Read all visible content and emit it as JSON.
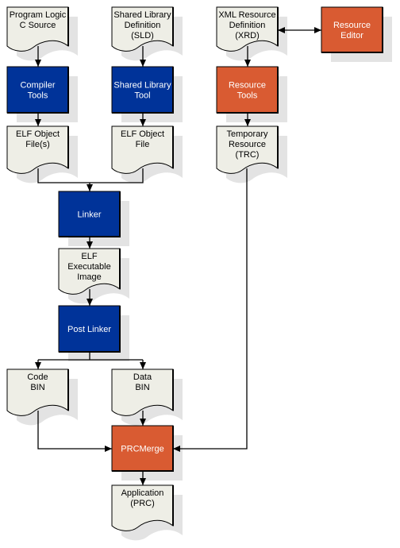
{
  "colors": {
    "process_blue": "#003399",
    "process_orange": "#d95b32",
    "document_fill": "#eeeee6",
    "shadow": "#e3e3e3"
  },
  "nodes": {
    "program_logic": {
      "kind": "document",
      "lines": [
        "Program Logic",
        "C Source"
      ]
    },
    "sld": {
      "kind": "document",
      "lines": [
        "Shared Library",
        "Definition",
        "(SLD)"
      ]
    },
    "xrd": {
      "kind": "document",
      "lines": [
        "XML Resource",
        "Definition",
        "(XRD)"
      ]
    },
    "resource_editor": {
      "kind": "process",
      "color": "orange",
      "lines": [
        "Resource",
        "Editor"
      ]
    },
    "compiler_tools": {
      "kind": "process",
      "color": "blue",
      "lines": [
        "Compiler",
        "Tools"
      ]
    },
    "shared_library_tool": {
      "kind": "process",
      "color": "blue",
      "lines": [
        "Shared Library",
        "Tool"
      ]
    },
    "resource_tools": {
      "kind": "process",
      "color": "orange",
      "lines": [
        "Resource",
        "Tools"
      ]
    },
    "elf_object_files": {
      "kind": "document",
      "lines": [
        "ELF Object",
        "File(s)"
      ]
    },
    "elf_object_file": {
      "kind": "document",
      "lines": [
        "ELF Object",
        "File"
      ]
    },
    "trc": {
      "kind": "document",
      "lines": [
        "Temporary",
        "Resource",
        "(TRC)"
      ]
    },
    "linker": {
      "kind": "process",
      "color": "blue",
      "lines": [
        "Linker"
      ]
    },
    "elf_executable": {
      "kind": "document",
      "lines": [
        "ELF",
        "Executable",
        "Image"
      ]
    },
    "post_linker": {
      "kind": "process",
      "color": "blue",
      "lines": [
        "Post Linker"
      ]
    },
    "code_bin": {
      "kind": "document",
      "lines": [
        "Code",
        "BIN"
      ]
    },
    "data_bin": {
      "kind": "document",
      "lines": [
        "Data",
        "BIN"
      ]
    },
    "prcmerge": {
      "kind": "process",
      "color": "orange",
      "lines": [
        "PRCMerge"
      ]
    },
    "application": {
      "kind": "document",
      "lines": [
        "Application",
        "(PRC)"
      ]
    }
  },
  "edges": [
    {
      "from": "program_logic",
      "to": "compiler_tools"
    },
    {
      "from": "compiler_tools",
      "to": "elf_object_files"
    },
    {
      "from": "sld",
      "to": "shared_library_tool"
    },
    {
      "from": "shared_library_tool",
      "to": "elf_object_file"
    },
    {
      "from": "xrd",
      "to": "resource_editor",
      "bidirectional": true
    },
    {
      "from": "xrd",
      "to": "resource_tools"
    },
    {
      "from": "resource_tools",
      "to": "trc"
    },
    {
      "from": "elf_object_files",
      "to": "linker"
    },
    {
      "from": "elf_object_file",
      "to": "linker"
    },
    {
      "from": "linker",
      "to": "elf_executable"
    },
    {
      "from": "elf_executable",
      "to": "post_linker"
    },
    {
      "from": "post_linker",
      "to": "code_bin"
    },
    {
      "from": "post_linker",
      "to": "data_bin"
    },
    {
      "from": "code_bin",
      "to": "prcmerge"
    },
    {
      "from": "data_bin",
      "to": "prcmerge"
    },
    {
      "from": "trc",
      "to": "prcmerge"
    },
    {
      "from": "prcmerge",
      "to": "application"
    }
  ]
}
